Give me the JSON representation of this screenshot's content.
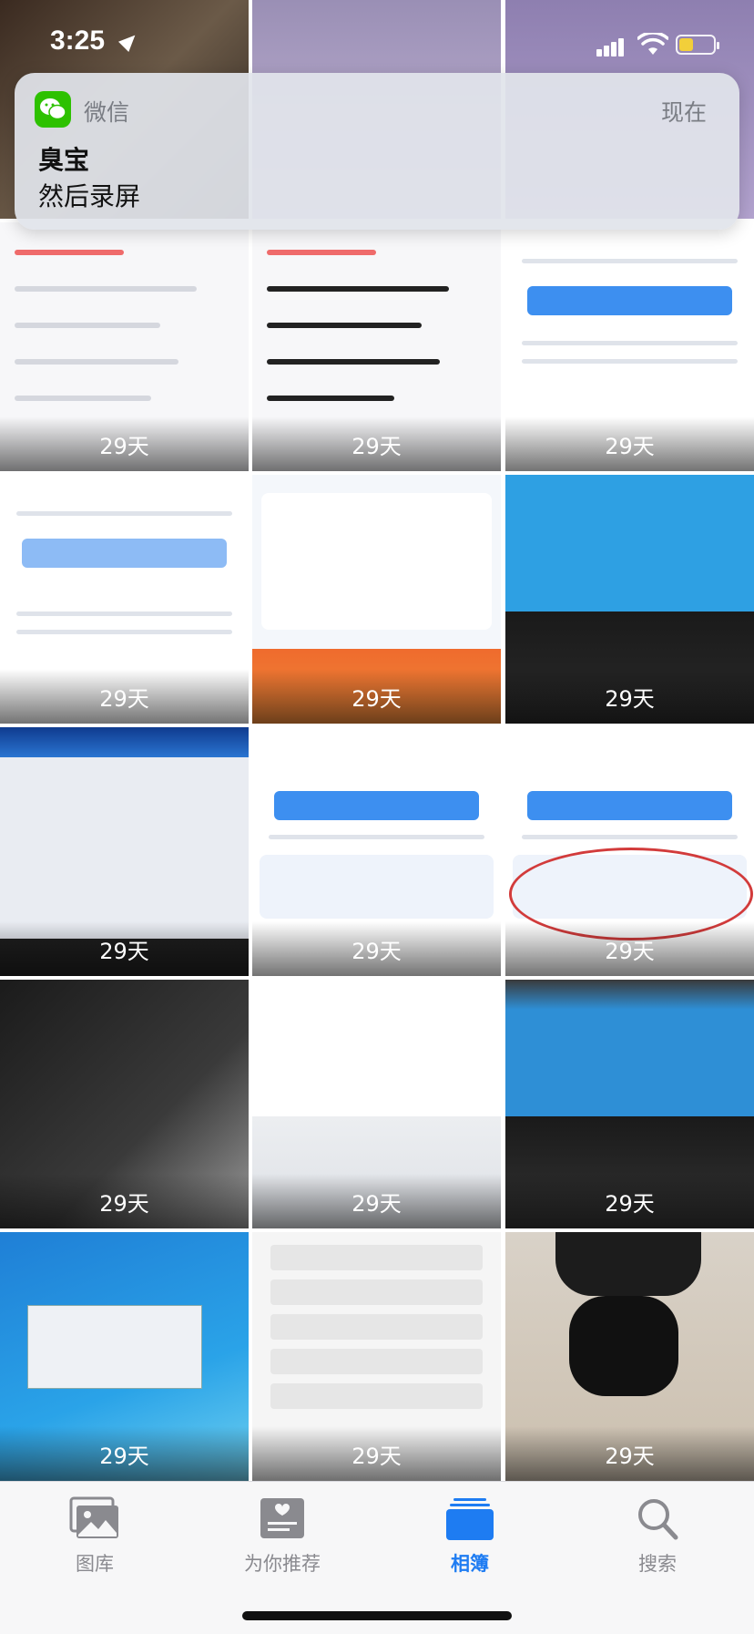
{
  "status_bar": {
    "time": "3:25"
  },
  "notification": {
    "app_name": "微信",
    "time": "现在",
    "sender": "臭宝",
    "message": "然后录屏"
  },
  "grid": {
    "rows": [
      [
        "",
        "",
        ""
      ],
      [
        "29天",
        "29天",
        "29天"
      ],
      [
        "29天",
        "29天",
        "29天"
      ],
      [
        "29天",
        "29天",
        "29天"
      ],
      [
        "29天",
        "29天",
        "29天"
      ],
      [
        "29天",
        "29天",
        "29天"
      ]
    ]
  },
  "tabs": [
    {
      "label": "图库",
      "icon": "photo-library-icon",
      "active": false
    },
    {
      "label": "为你推荐",
      "icon": "for-you-icon",
      "active": false
    },
    {
      "label": "相簿",
      "icon": "albums-icon",
      "active": true
    },
    {
      "label": "搜索",
      "icon": "search-icon",
      "active": false
    }
  ],
  "colors": {
    "accent": "#1e7cf2",
    "wechat_green": "#2dc100",
    "battery": "#f2cf3a"
  }
}
